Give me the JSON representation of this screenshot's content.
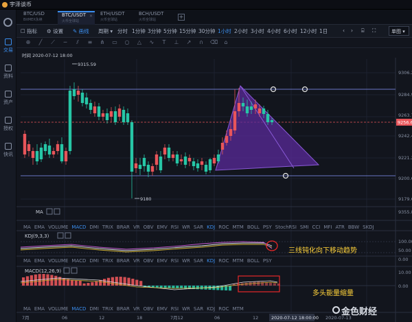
{
  "app": {
    "title": "宇泽谈币"
  },
  "sidebar": {
    "items": [
      {
        "label": "交易",
        "icon": "trade-icon",
        "active": true
      },
      {
        "label": "资料",
        "icon": "info-icon",
        "active": false
      },
      {
        "label": "资产",
        "icon": "wallet-icon",
        "active": false
      },
      {
        "label": "授权",
        "icon": "auth-icon",
        "active": false
      },
      {
        "label": "快讯",
        "icon": "news-icon",
        "active": false
      }
    ]
  },
  "tabs": [
    {
      "label": "BTC/USD",
      "sub": "BitMEX永续",
      "active": false
    },
    {
      "label": "BTC/USDT",
      "sub": "火币全球站",
      "active": true
    },
    {
      "label": "ETH/USDT",
      "sub": "火币全球站",
      "active": false
    },
    {
      "label": "BCH/USDT",
      "sub": "火币全球站",
      "active": false
    }
  ],
  "toolbar": {
    "items": [
      "指标",
      "设置",
      "画线"
    ],
    "periods": [
      "周期",
      "分时",
      "1分钟",
      "3分钟",
      "5分钟",
      "15分钟",
      "30分钟",
      "1小时",
      "2小时",
      "3小时",
      "4小时",
      "6小时",
      "12小时",
      "1日"
    ],
    "active_period": "1小时",
    "display": "单图"
  },
  "chart": {
    "time_label": "时间 2020-07-12 18:00",
    "high_label": "9315.59",
    "low_label": "9180",
    "current_price": "9256.64",
    "price_ticks": [
      "9306.22",
      "9284.95",
      "9263.71",
      "9242.45",
      "9221.21",
      "9200.62",
      "9179.68"
    ],
    "ma_label": "MA",
    "ma_axis": "9355.81",
    "kdj_label": "KDJ(9,3,3)",
    "kdj_ticks": [
      "100.00",
      "50.00",
      "0.00"
    ],
    "macd_label": "MACD(12,26,9)",
    "macd_ticks": [
      "10.00",
      "0.00"
    ],
    "date_labels": [
      "7月",
      "06",
      "12",
      "18",
      "7月12",
      "06",
      "12"
    ],
    "crosshair_time": "2020-07-12 18:00:00",
    "crosshair_date": "2020-07-13"
  },
  "indicator_tabs": [
    "MA",
    "EMA",
    "VOLUME",
    "MACD",
    "DMI",
    "TRIX",
    "BRAR",
    "VR",
    "OBV",
    "EMV",
    "RSI",
    "WR",
    "SAR",
    "KDJ",
    "ROC",
    "MTM",
    "BOLL",
    "PSY",
    "StochRSI",
    "SMI",
    "CCI",
    "MFI",
    "ATR",
    "BBW",
    "SKDJ"
  ],
  "indicator_tabs_short": [
    "MA",
    "EMA",
    "VOLUME",
    "MACD",
    "DMI",
    "TRIX",
    "BRAR",
    "VR",
    "OBV",
    "EMV",
    "RSI",
    "WR",
    "SAR",
    "KDJ",
    "ROC",
    "MTM",
    "BOLL",
    "PSY"
  ],
  "indicator_tabs_short2": [
    "MA",
    "EMA",
    "VOLUME",
    "MACD",
    "DMI",
    "TRIX",
    "BRAR",
    "VR",
    "OBV",
    "EMV",
    "RSI",
    "WR",
    "SAR",
    "KDJ",
    "ROC",
    "MTM"
  ],
  "annotations": {
    "kdj_note": "三线钝化向下移动趋势",
    "macd_note": "多头能量缩量"
  },
  "watermark": "金色财经",
  "colors": {
    "up": "#e8555a",
    "down": "#26c6a6",
    "accent": "#3b8ff0",
    "note": "#ffd23a",
    "triangle": "#6a2fa8"
  }
}
